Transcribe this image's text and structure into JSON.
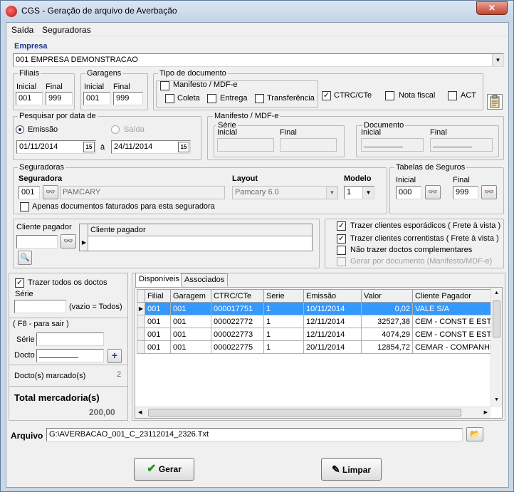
{
  "window": {
    "title": "CGS - Geração de arquivo de Averbação",
    "close": "×"
  },
  "menu": [
    "Saída",
    "Seguradoras"
  ],
  "empresa": {
    "label": "Empresa",
    "value": "001 EMPRESA DEMONSTRACAO"
  },
  "filiais": {
    "title": "Filiais",
    "inicial_label": "Inicial",
    "final_label": "Final",
    "inicial": "001",
    "final": "999"
  },
  "garagens": {
    "title": "Garagens",
    "inicial_label": "Inicial",
    "final_label": "Final",
    "inicial": "001",
    "final": "999"
  },
  "tipo_documento": {
    "title": "Tipo de documento",
    "manifesto": "Manifesto / MDF-e",
    "coleta": "Coleta",
    "entrega": "Entrega",
    "transferencia": "Transferência",
    "ctrc": "CTRC/CTe",
    "ctrc_checked": true,
    "nota_fiscal": "Nota fiscal",
    "act": "ACT"
  },
  "pesquisar": {
    "title": "Pesquisar por data de",
    "emissao": "Emissão",
    "saida": "Saída",
    "data_inicial": "01/11/2014",
    "a": "à",
    "data_final": "24/11/2014",
    "cal": "15"
  },
  "manifesto_group": {
    "title": "Manifesto / MDF-e",
    "serie": "Série",
    "inicial": "Inicial",
    "final": "Final",
    "documento": "Documento",
    "doc_inicial": "Inicial",
    "doc_final": "Final"
  },
  "seguradoras": {
    "title": "Seguradoras",
    "seguradora_label": "Seguradora",
    "codigo": "001",
    "nome": "PAMCARY",
    "layout_label": "Layout",
    "layout": "Pamcary 6.0",
    "modelo_label": "Modelo",
    "modelo": "1",
    "apenas_faturados": "Apenas documentos faturados para esta seguradora"
  },
  "tabelas_seguros": {
    "title": "Tabelas de Seguros",
    "inicial_label": "Inicial",
    "final_label": "Final",
    "inicial": "000",
    "final": "999"
  },
  "cliente_pagador": {
    "label": "Cliente pagador",
    "grid_header": "Cliente pagador",
    "value": ""
  },
  "opcoes": {
    "esporadicos": "Trazer clientes esporádicos ( Frete à vista )",
    "correntistas": "Trazer clientes correntistas  ( Frete à vista )",
    "nao_complementares": "Não trazer doctos complementares",
    "gerar_por_documento": "Gerar por documento (Manifesto/MDF-e)"
  },
  "left_panel": {
    "trazer_todos": "Trazer todos os doctos",
    "serie_label": "Série",
    "vazio": "(vazio = Todos)",
    "f8": "( F8 - para sair )",
    "serie2": "Série",
    "docto": "Docto",
    "marcados_label": "Docto(s) marcado(s)",
    "marcados_value": "2",
    "total_label": "Total mercadoria(s)",
    "total_value": "200,00"
  },
  "tabs": [
    "Disponíveis",
    "Associados"
  ],
  "grid": {
    "columns": [
      "Filial",
      "Garagem",
      "CTRC/CTe",
      "Serie",
      "Emissão",
      "Valor",
      "Cliente Pagador"
    ],
    "rows": [
      [
        "001",
        "001",
        "000017751",
        "1",
        "10/11/2014",
        "0,02",
        "VALE S/A"
      ],
      [
        "001",
        "001",
        "000022772",
        "1",
        "12/11/2014",
        "32527,38",
        "CEM - CONST E ESTR"
      ],
      [
        "001",
        "001",
        "000022773",
        "1",
        "12/11/2014",
        "4074,29",
        "CEM - CONST E ESTR"
      ],
      [
        "001",
        "001",
        "000022775",
        "1",
        "20/11/2014",
        "12854,72",
        "CEMAR - COMPANHIA"
      ]
    ]
  },
  "arquivo": {
    "label": "Arquivo",
    "value": "G:\\AVERBACAO_001_C_23112014_2326.Txt"
  },
  "buttons": {
    "gerar": "Gerar",
    "limpar": "Limpar"
  }
}
